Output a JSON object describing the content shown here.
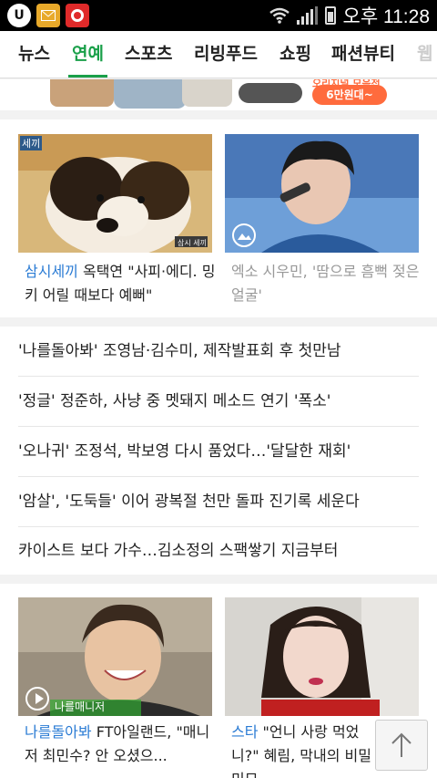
{
  "status_bar": {
    "time": "오후 11:28",
    "icons": [
      "u-plus-icon",
      "mail-icon",
      "app-badge-icon",
      "wifi-icon",
      "signal-icon",
      "battery-icon"
    ]
  },
  "tabs": [
    {
      "label": "뉴스",
      "active": false
    },
    {
      "label": "연예",
      "active": true
    },
    {
      "label": "스포츠",
      "active": false
    },
    {
      "label": "리빙푸드",
      "active": false
    },
    {
      "label": "쇼핑",
      "active": false
    },
    {
      "label": "패션뷰티",
      "active": false
    },
    {
      "label": "웹",
      "active": false
    }
  ],
  "banner": {
    "price_badge": "6만원대~",
    "pretext": "오리지널 모음전"
  },
  "section1": {
    "items": [
      {
        "source": "삼시세끼",
        "title": "옥택연 \"사피·에디. 밍키 어릴 때보다 예뻐\"",
        "thumb_caption": "세끼",
        "corner_caption": "삼시 세끼"
      },
      {
        "source": "",
        "title": "엑소 시우민, '땀으로 흠뻑 젖은 얼굴'",
        "has_gallery_icon": true
      }
    ]
  },
  "headlines": [
    "'나를돌아봐' 조영남·김수미, 제작발표회 후 첫만남",
    "'정글' 정준하, 사냥 중 멧돼지 메소드 연기 '폭소'",
    "'오나귀' 조정석, 박보영 다시 품었다…'달달한 재회'",
    "'암살', '도둑들' 이어 광복절 천만 돌파 진기록 세운다",
    "카이스트 보다 가수…김소정의 스팩쌓기 지금부터"
  ],
  "section2": {
    "items": [
      {
        "source": "나를돌아봐",
        "title": "FT아일랜드, \"매니저 최민수? 안 오셨으...",
        "thumb_caption": "나를매니저"
      },
      {
        "source": "스타",
        "title": "\"언니 사랑 먹었니?\" 혜림, 막내의 비밀 미모"
      }
    ]
  },
  "accent": "#1aa04a",
  "link_color": "#2a7bd4"
}
